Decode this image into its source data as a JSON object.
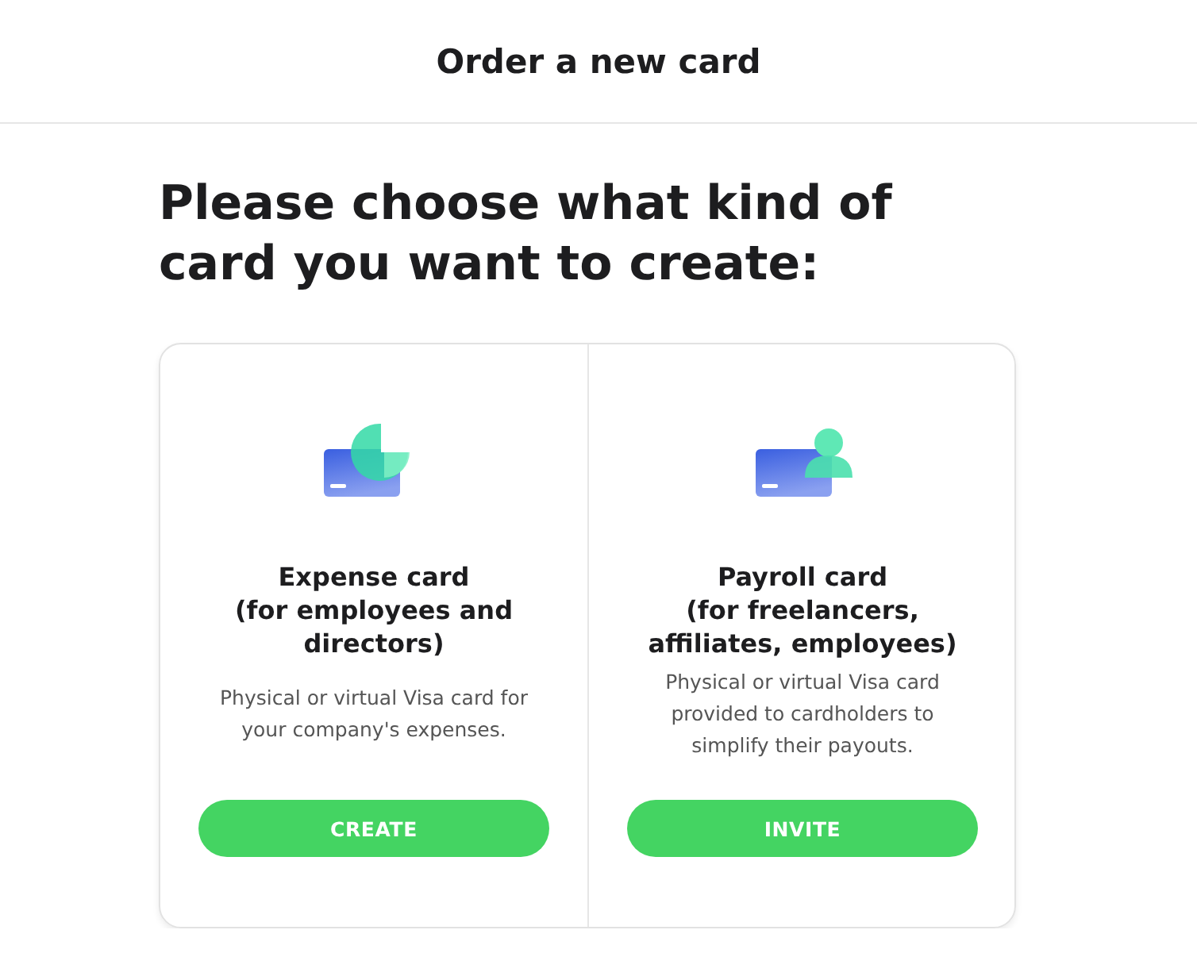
{
  "header": {
    "title": "Order a new card"
  },
  "heading": "Please choose what kind of\ncard you want to create:",
  "options": [
    {
      "title": "Expense card\n(for employees and\ndirectors)",
      "description": "Physical or virtual Visa card for\nyour company's expenses.",
      "button": "CREATE"
    },
    {
      "title": "Payroll card\n(for freelancers,\naffiliates, employees)",
      "description": "Physical or virtual Visa card\nprovided to cardholders to\nsimplify their payouts.",
      "button": "INVITE"
    }
  ]
}
